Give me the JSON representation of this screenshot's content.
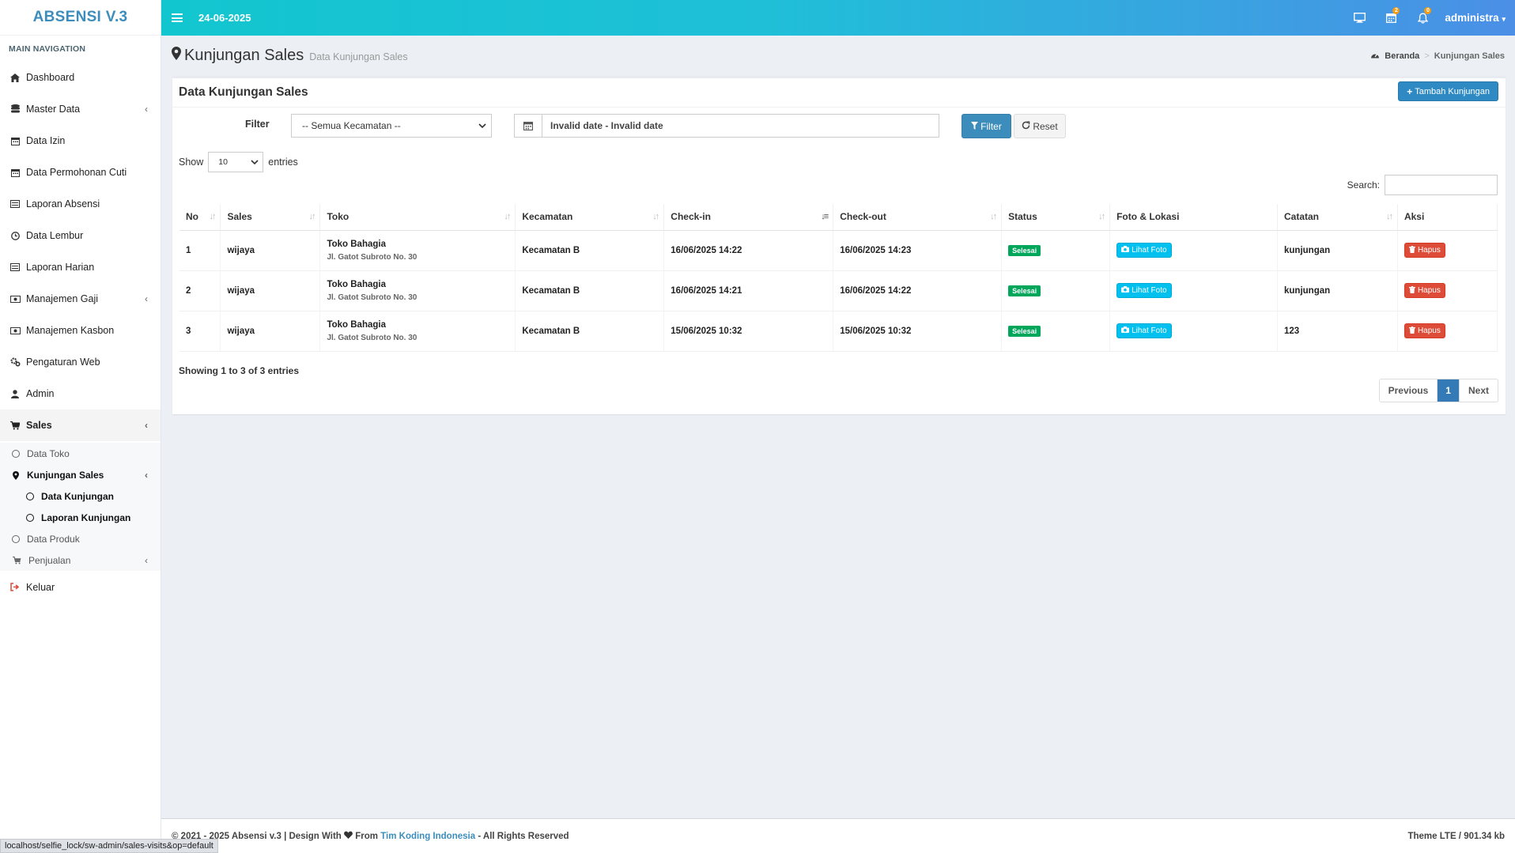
{
  "app": {
    "logo": "ABSENSI V.3"
  },
  "header": {
    "date": "24-06-2025",
    "user": "administra",
    "badges": {
      "calendar": "2",
      "bell": "0"
    }
  },
  "sidebar": {
    "nav_header": "MAIN NAVIGATION",
    "items": [
      {
        "label": "Dashboard",
        "icon": "home-icon"
      },
      {
        "label": "Master Data",
        "icon": "database-icon"
      },
      {
        "label": "Data Izin",
        "icon": "calendar-icon"
      },
      {
        "label": "Data Permohonan Cuti",
        "icon": "calendar-icon"
      },
      {
        "label": "Laporan Absensi",
        "icon": "list-icon"
      },
      {
        "label": "Data Lembur",
        "icon": "clock-icon"
      },
      {
        "label": "Laporan Harian",
        "icon": "list-icon"
      },
      {
        "label": "Manajemen Gaji",
        "icon": "money-icon"
      },
      {
        "label": "Manajemen Kasbon",
        "icon": "money-icon"
      },
      {
        "label": "Pengaturan Web",
        "icon": "gears-icon"
      },
      {
        "label": "Admin",
        "icon": "user-icon"
      },
      {
        "label": "Sales",
        "icon": "cart-icon"
      }
    ],
    "sales_sub": {
      "data_toko": "Data Toko",
      "kunjungan_sales": "Kunjungan Sales",
      "data_kunjungan": "Data Kunjungan",
      "laporan_kunjungan": "Laporan Kunjungan",
      "data_produk": "Data Produk",
      "penjualan": "Penjualan"
    },
    "logout": "Keluar"
  },
  "page": {
    "title": "Kunjungan Sales",
    "subtitle": "Data Kunjungan Sales",
    "breadcrumb": {
      "home": "Beranda",
      "current": "Kunjungan Sales"
    }
  },
  "box": {
    "title": "Data Kunjungan Sales",
    "add_button": "Tambah Kunjungan",
    "filter_label": "Filter",
    "kecamatan_select": "-- Semua Kecamatan --",
    "date_range": "Invalid date - Invalid date",
    "filter_button": "Filter",
    "reset_button": "Reset",
    "show_label": "Show",
    "entries_label": "entries",
    "page_length": "10",
    "search_label": "Search:"
  },
  "table": {
    "columns": [
      "No",
      "Sales",
      "Toko",
      "Kecamatan",
      "Check-in",
      "Check-out",
      "Status",
      "Foto & Lokasi",
      "Catatan",
      "Aksi"
    ],
    "rows": [
      {
        "no": "1",
        "sales": "wijaya",
        "toko": "Toko Bahagia",
        "alamat": "Jl. Gatot Subroto No. 30",
        "kecamatan": "Kecamatan B",
        "checkin": "16/06/2025 14:22",
        "checkout": "16/06/2025 14:23",
        "status": "Selesai",
        "foto": "Lihat Foto",
        "catatan": "kunjungan",
        "aksi": "Hapus"
      },
      {
        "no": "2",
        "sales": "wijaya",
        "toko": "Toko Bahagia",
        "alamat": "Jl. Gatot Subroto No. 30",
        "kecamatan": "Kecamatan B",
        "checkin": "16/06/2025 14:21",
        "checkout": "16/06/2025 14:22",
        "status": "Selesai",
        "foto": "Lihat Foto",
        "catatan": "kunjungan",
        "aksi": "Hapus"
      },
      {
        "no": "3",
        "sales": "wijaya",
        "toko": "Toko Bahagia",
        "alamat": "Jl. Gatot Subroto No. 30",
        "kecamatan": "Kecamatan B",
        "checkin": "15/06/2025 10:32",
        "checkout": "15/06/2025 10:32",
        "status": "Selesai",
        "foto": "Lihat Foto",
        "catatan": "123",
        "aksi": "Hapus"
      }
    ],
    "info": "Showing 1 to 3 of 3 entries",
    "pager": {
      "previous": "Previous",
      "current": "1",
      "next": "Next"
    }
  },
  "footer": {
    "left_prefix": "© 2021 - 2025 Absensi v.3 | Design With",
    "left_from": "From",
    "left_link": "Tim Koding Indonesia",
    "left_suffix": "- All Rights Reserved",
    "right": "Theme LTE / 901.34 kb"
  },
  "statusbar": "localhost/selfie_lock/sw-admin/sales-visits&op=default",
  "colors": {
    "accent": "#3c8dbc",
    "success": "#00a65a",
    "danger": "#dd4b39",
    "info": "#00c0ef"
  }
}
